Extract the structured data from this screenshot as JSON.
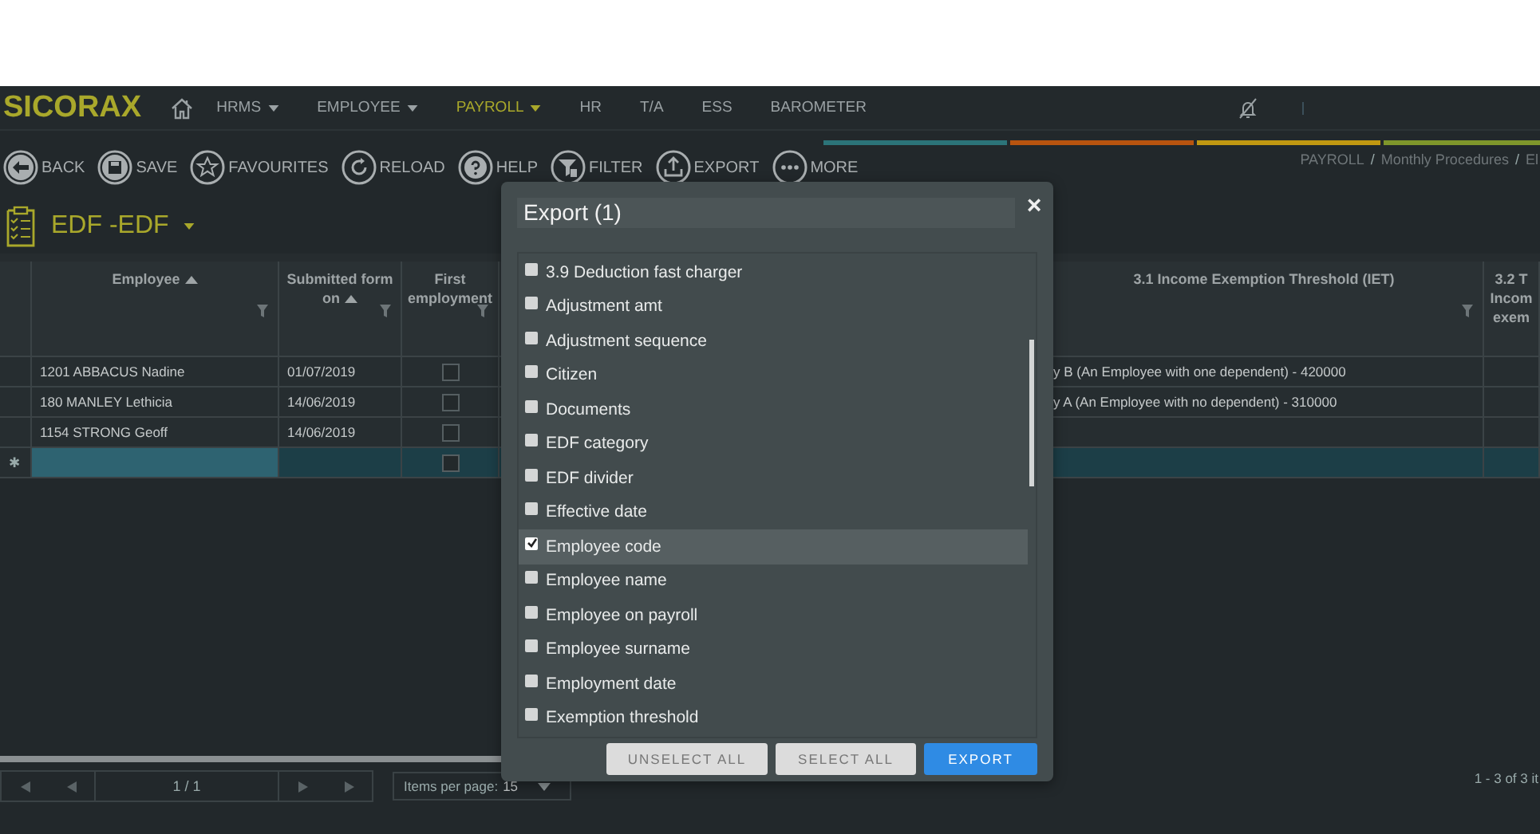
{
  "app": {
    "logo": "SICORAX"
  },
  "nav_menu": [
    {
      "label": "HRMS",
      "has_dropdown": true,
      "selected": false
    },
    {
      "label": "EMPLOYEE",
      "has_dropdown": true,
      "selected": false
    },
    {
      "label": "PAYROLL",
      "has_dropdown": true,
      "selected": true
    },
    {
      "label": "HR",
      "has_dropdown": false,
      "selected": false
    },
    {
      "label": "T/A",
      "has_dropdown": false,
      "selected": false
    },
    {
      "label": "ESS",
      "has_dropdown": false,
      "selected": false
    },
    {
      "label": "BAROMETER",
      "has_dropdown": false,
      "selected": false
    }
  ],
  "toolbar": [
    {
      "label": "BACK"
    },
    {
      "label": "SAVE"
    },
    {
      "label": "FAVOURITES"
    },
    {
      "label": "RELOAD"
    },
    {
      "label": "HELP"
    },
    {
      "label": "FILTER"
    },
    {
      "label": "EXPORT"
    },
    {
      "label": "MORE"
    }
  ],
  "breadcrumb": {
    "separator": "/",
    "items": [
      "PAYROLL",
      "Monthly Procedures",
      "El"
    ]
  },
  "page_title": {
    "text": "EDF -EDF",
    "has_dropdown": true
  },
  "table": {
    "columns": [
      {
        "label": "Employee",
        "sorted": true,
        "filterable": true
      },
      {
        "label": "Submitted form on",
        "sorted": true,
        "filterable": true
      },
      {
        "label": "First employment",
        "sorted": false,
        "filterable": true
      },
      {
        "label": "3.1 Income Exemption Threshold (IET)",
        "sorted": false,
        "filterable": true
      },
      {
        "label": "3.2 T\nIncom\nexem",
        "sorted": false,
        "filterable": false
      }
    ],
    "rows": [
      {
        "kind": "data",
        "employee": "1201 ABBACUS Nadine",
        "submitted_on": "01/07/2019",
        "first_employment": false,
        "iet": "y B (An Employee with one dependent) - 420000"
      },
      {
        "kind": "data",
        "employee": "180 MANLEY Lethicia",
        "submitted_on": "14/06/2019",
        "first_employment": false,
        "iet": "y A (An Employee with no dependent) - 310000"
      },
      {
        "kind": "data",
        "employee": "1154 STRONG Geoff",
        "submitted_on": "14/06/2019",
        "first_employment": false
      },
      {
        "kind": "new",
        "marker": "✱",
        "first_employment": false
      }
    ]
  },
  "pager": {
    "page": "1 / 1",
    "items_per_page_label": "Items per page:",
    "items_per_page": "15",
    "summary": "1 - 3 of 3 it"
  },
  "export_dialog": {
    "title": "Export (1)",
    "close": "×",
    "fields": [
      {
        "label": "3.9 Deduction fast charger",
        "checked": false,
        "selected": false
      },
      {
        "label": "Adjustment amt",
        "checked": false,
        "selected": false
      },
      {
        "label": "Adjustment sequence",
        "checked": false,
        "selected": false
      },
      {
        "label": "Citizen",
        "checked": false,
        "selected": false
      },
      {
        "label": "Documents",
        "checked": false,
        "selected": false
      },
      {
        "label": "EDF category",
        "checked": false,
        "selected": false
      },
      {
        "label": "EDF divider",
        "checked": false,
        "selected": false
      },
      {
        "label": "Effective date",
        "checked": false,
        "selected": false
      },
      {
        "label": "Employee code",
        "checked": true,
        "selected": true
      },
      {
        "label": "Employee name",
        "checked": false,
        "selected": false
      },
      {
        "label": "Employee on payroll",
        "checked": false,
        "selected": false
      },
      {
        "label": "Employee surname",
        "checked": false,
        "selected": false
      },
      {
        "label": "Employment date",
        "checked": false,
        "selected": false
      },
      {
        "label": "Exemption threshold",
        "checked": false,
        "selected": false
      }
    ],
    "buttons": [
      {
        "label": "UNSELECT ALL",
        "kind": "secondary"
      },
      {
        "label": "SELECT ALL",
        "kind": "secondary"
      },
      {
        "label": "EXPORT",
        "kind": "primary"
      }
    ]
  }
}
